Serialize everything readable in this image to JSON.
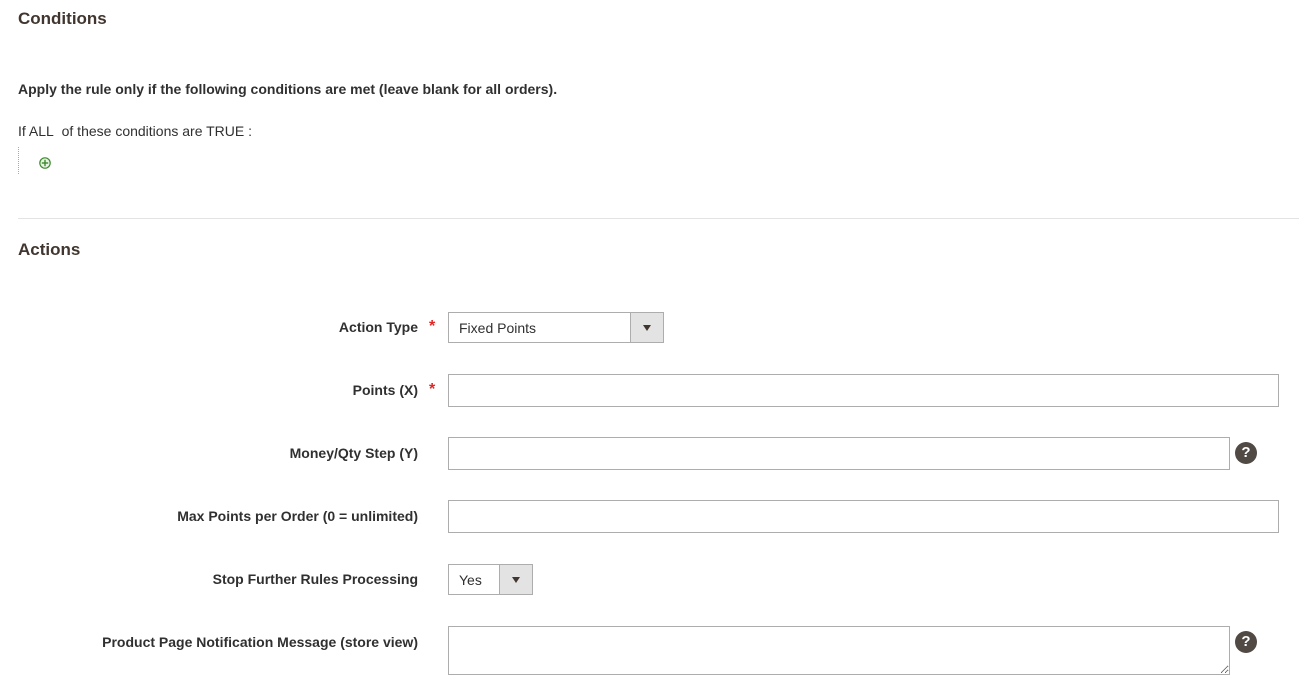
{
  "conditions": {
    "title": "Conditions",
    "intro": "Apply the rule only if the following conditions are met (leave blank for all orders).",
    "line_prefix": "If",
    "aggregator": "ALL",
    "line_middle": "of these conditions are",
    "value": "TRUE",
    "line_suffix": ":"
  },
  "actions": {
    "title": "Actions",
    "fields": {
      "action_type": {
        "label": "Action Type",
        "required_mark": "*",
        "value": "Fixed Points"
      },
      "points": {
        "label": "Points (X)",
        "required_mark": "*",
        "value": ""
      },
      "money_step": {
        "label": "Money/Qty Step (Y)",
        "value": "",
        "help": "?"
      },
      "max_points": {
        "label": "Max Points per Order (0 = unlimited)",
        "value": ""
      },
      "stop_processing": {
        "label": "Stop Further Rules Processing",
        "value": "Yes"
      },
      "notification": {
        "label": "Product Page Notification Message (store view)",
        "value": "",
        "help": "?"
      }
    }
  },
  "icons": {
    "add_condition": "add-circle-icon",
    "help": "help-icon",
    "dropdown": "chevron-down-icon"
  },
  "colors": {
    "required": "#e22626",
    "help_bg": "#514943",
    "add_icon": "#3d8a2d"
  }
}
